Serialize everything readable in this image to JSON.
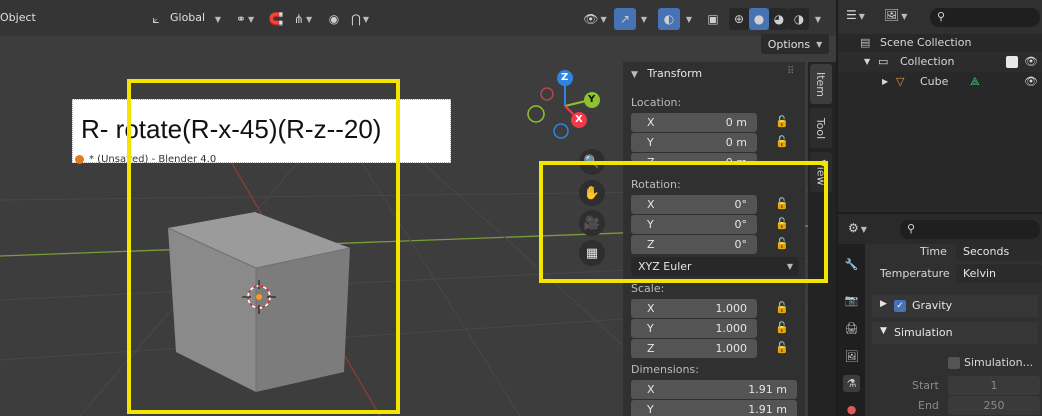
{
  "header": {
    "mode": "Object",
    "orientation": "Global"
  },
  "options_label": "Options",
  "overlay": {
    "title": "R- rotate(R-x-45)(R-z--20)",
    "subtitle": "* (Unsaved) - Blender 4.0"
  },
  "gizmo": {
    "x": "X",
    "y": "Y",
    "z": "Z"
  },
  "npanel": {
    "tabs": [
      "Item",
      "Tool",
      "View"
    ],
    "title": "Transform",
    "location_label": "Location:",
    "location": [
      {
        "axis": "X",
        "value": "0 m"
      },
      {
        "axis": "Y",
        "value": "0 m"
      },
      {
        "axis": "Z",
        "value": "0 m"
      }
    ],
    "rotation_label": "Rotation:",
    "rotation": [
      {
        "axis": "X",
        "value": "0°"
      },
      {
        "axis": "Y",
        "value": "0°"
      },
      {
        "axis": "Z",
        "value": "0°"
      }
    ],
    "rotation_mode": "XYZ Euler",
    "scale_label": "Scale:",
    "scale": [
      {
        "axis": "X",
        "value": "1.000"
      },
      {
        "axis": "Y",
        "value": "1.000"
      },
      {
        "axis": "Z",
        "value": "1.000"
      }
    ],
    "dimensions_label": "Dimensions:",
    "dimensions": [
      {
        "axis": "X",
        "value": "1.91 m"
      },
      {
        "axis": "Y",
        "value": "1.91 m"
      }
    ]
  },
  "outliner": {
    "scene_collection": "Scene Collection",
    "collection": "Collection",
    "cube": "Cube"
  },
  "properties": {
    "time_label": "Time",
    "time_value": "Seconds",
    "temperature_label": "Temperature",
    "temperature_value": "Kelvin",
    "gravity": "Gravity",
    "simulation": "Simulation",
    "simulation_checkbox": "Simulation...",
    "start_label": "Start",
    "start_value": "1",
    "end_label": "End",
    "end_value": "250"
  },
  "colors": {
    "highlight": "#f2e600",
    "accent": "#4772b3",
    "axis_x": "#f0394a",
    "axis_y": "#8fc231",
    "axis_z": "#2f84e3"
  }
}
